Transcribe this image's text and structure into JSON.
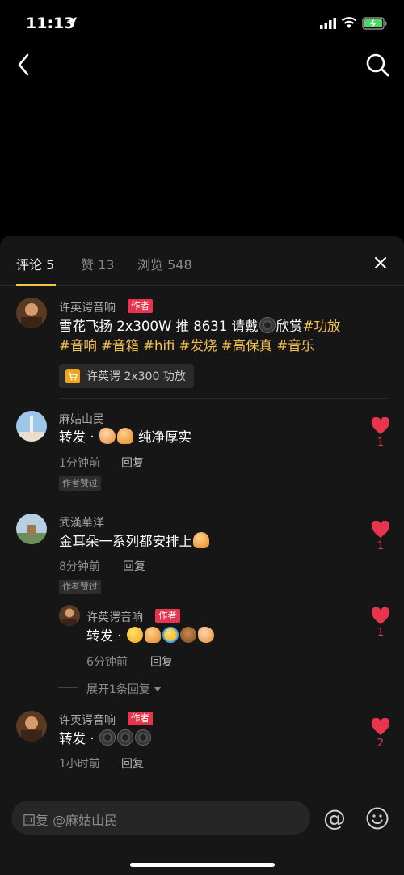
{
  "status_bar": {
    "time": "11:13"
  },
  "tabs": [
    {
      "label": "评论 5"
    },
    {
      "label": "赞 13"
    },
    {
      "label": "浏览 548"
    }
  ],
  "comments": [
    {
      "user": "许英谔音响",
      "tag": "作者",
      "text_plain_1": "雪花飞扬 2x300W 推 8631 请戴",
      "text_plain_2": "欣赏",
      "hashtags_line1": "#功放",
      "hashtags_line2": [
        "#音响",
        "#音箱",
        "#hifi",
        "#发烧",
        "#高保真",
        "#音乐"
      ],
      "product": "许英谔 2x300 功放"
    },
    {
      "user": "麻姑山民",
      "text_prefix": "转发 ·",
      "text_suffix": "纯净厚实",
      "time": "1分钟前",
      "reply": "回复",
      "badge": "作者赞过",
      "likes": "1"
    },
    {
      "user": "武漢華洋",
      "text": "金耳朵一系列都安排上",
      "time": "8分钟前",
      "reply": "回复",
      "badge": "作者赞过",
      "likes": "1",
      "sub_reply": {
        "user": "许英谔音响",
        "tag": "作者",
        "text_prefix": "转发 ·",
        "time": "6分钟前",
        "reply": "回复",
        "likes": "1"
      },
      "expand_label": "展开1条回复"
    },
    {
      "user": "许英谔音响",
      "tag": "作者",
      "text_prefix": "转发 ·",
      "time": "1小时前",
      "reply": "回复",
      "likes": "2"
    }
  ],
  "input": {
    "placeholder": "回复 @麻姑山民"
  },
  "colors": {
    "accent": "#f7c443",
    "like": "#e8344d",
    "author_tag": "#e8344d",
    "hashtag": "#f3c14f"
  }
}
